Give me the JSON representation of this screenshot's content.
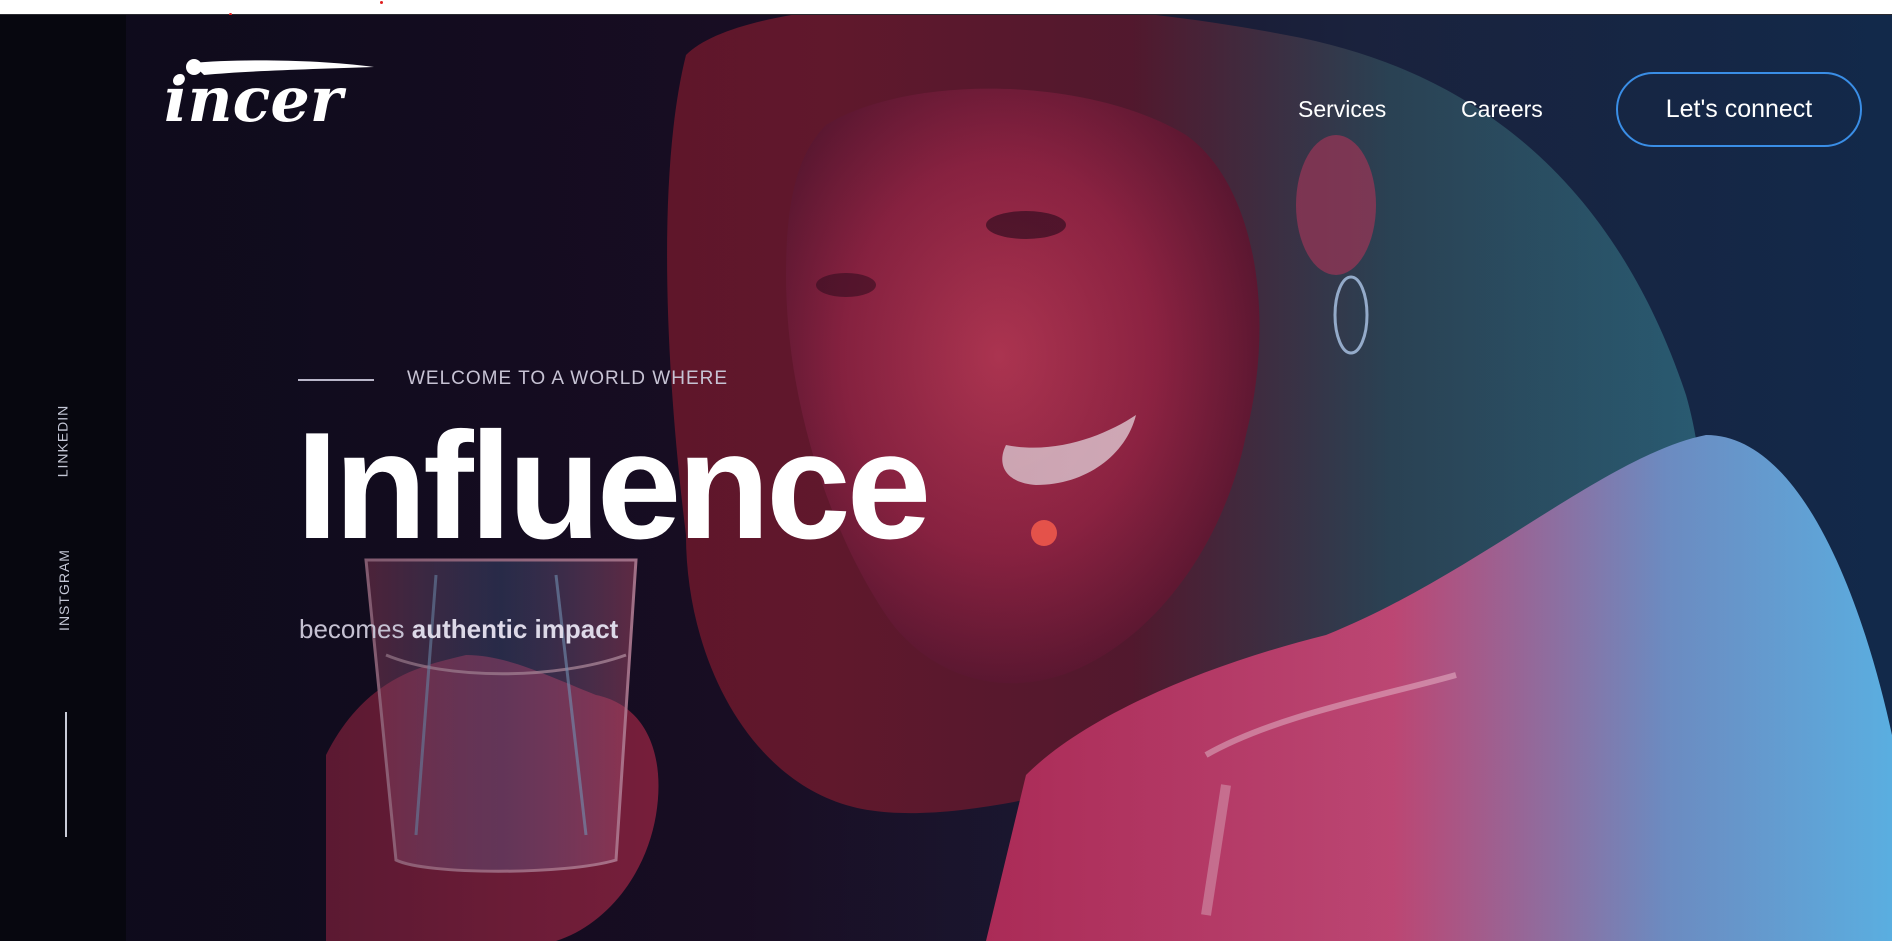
{
  "brand": {
    "logo_text": "incer"
  },
  "nav": {
    "items": [
      {
        "label": "Services"
      },
      {
        "label": "Careers"
      }
    ],
    "cta_label": "Let's connect"
  },
  "social": [
    {
      "label": "LINKEDIN"
    },
    {
      "label": "INSTGRAM"
    }
  ],
  "hero": {
    "eyebrow": "WELCOME TO A WORLD WHERE",
    "headline": "Influence",
    "subline_start": "becomes ",
    "subline_emphasis": "authentic impact"
  },
  "colors": {
    "accent_dot": "#e4524a",
    "cta_border": "#3a8ee6",
    "rail": "#07070f"
  },
  "icons": [
    "logo-mark"
  ]
}
